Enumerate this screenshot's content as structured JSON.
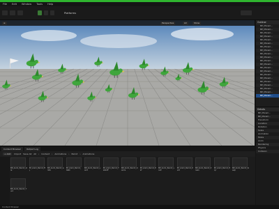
{
  "menu": [
    "File",
    "Edit",
    "Window",
    "Tools",
    "Help"
  ],
  "toolbar": {
    "mode_label": "Platforms",
    "play_label": ""
  },
  "viewport": {
    "perspective_label": "Perspective",
    "lit_label": "Lit",
    "show_label": "Show",
    "colors": {
      "sky_top": "#4f80b8",
      "sky_bottom": "#c8d5e0",
      "floor": "#a9a9a6",
      "floor_line": "#707070",
      "bird_body": "#3fa63c",
      "bird_beak": "#e2c84a"
    }
  },
  "outliner": {
    "title": "Outliner",
    "rows": [
      "BP_Mixam...",
      "BP_Mixam...",
      "BP_Mixam...",
      "BP_Mixam...",
      "BP_Mixam...",
      "BP_Mixam...",
      "BP_Mixam...",
      "BP_Mixam...",
      "BP_Mixam...",
      "BP_Mixam...",
      "BP_Mixam...",
      "BP_Mixam...",
      "BP_Mixam...",
      "BP_Mixam...",
      "BP_Mixam...",
      "BP_Mixam...",
      "BP_Mixam...",
      "BP_Mixam...",
      "BP_Mixam...",
      "BP_Mixam...",
      "BP_Mixam..."
    ],
    "selected_index": 20
  },
  "details": {
    "title": "Details",
    "rows": [
      "BP_Mixam...",
      "BP_Mixam...",
      "Transform",
      "Location",
      "Rotation",
      "Scale",
      "Animation",
      "Mode",
      "Anim",
      "Rendering",
      "Physics",
      "Collision"
    ]
  },
  "content_browser": {
    "tabs": [
      "Content Browser",
      "Output Log"
    ],
    "add_label": "+ Add",
    "import_label": "Import",
    "save_label": "Save All",
    "path": [
      "All",
      "Content",
      "Animations",
      "Parrot",
      "Animations"
    ],
    "assets": [
      "BP_Anim_Parrot_Idle",
      "BP_Anim_Parrot_Fly",
      "BP_Anim_Parrot_Glide",
      "BP_Anim_Parrot_Walk",
      "BP_Anim_Parrot_Land",
      "BP_Anim_Parrot_Takeoff",
      "BP_Anim_Parrot_Dance",
      "BP_Anim_Parrot_Eat",
      "BP_Anim_Parrot_Look",
      "BP_Anim_Parrot_Peck",
      "BP_Anim_Parrot_Preen",
      "BP_Anim_Parrot_Hop",
      "BP_Anim_Parrot_Sleep",
      "BP_Anim_Parrot_Turn"
    ]
  },
  "statusbar": "Content Drawer"
}
